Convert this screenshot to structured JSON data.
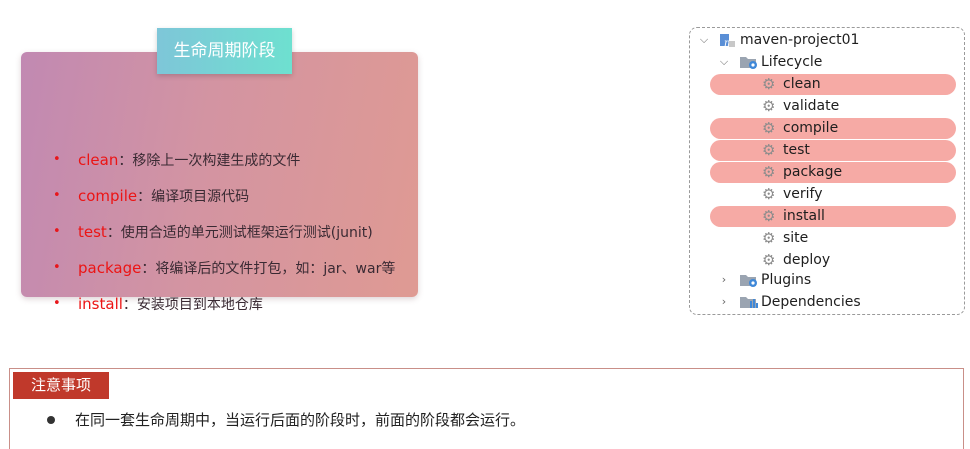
{
  "lifecycle_card": {
    "title": "生命周期阶段",
    "items": [
      {
        "term": "clean",
        "desc": "：移除上一次构建生成的文件"
      },
      {
        "term": "compile",
        "desc": "：编译项目源代码"
      },
      {
        "term": "test",
        "desc": "：使用合适的单元测试框架运行测试(junit)"
      },
      {
        "term": "package",
        "desc": "：将编译后的文件打包，如：jar、war等"
      },
      {
        "term": "install",
        "desc": "：安装项目到本地仓库"
      }
    ]
  },
  "project_tree": {
    "project": "maven-project01",
    "lifecycle_label": "Lifecycle",
    "phases": [
      {
        "label": "clean",
        "highlighted": true
      },
      {
        "label": "validate",
        "highlighted": false
      },
      {
        "label": "compile",
        "highlighted": true
      },
      {
        "label": "test",
        "highlighted": true
      },
      {
        "label": "package",
        "highlighted": true
      },
      {
        "label": "verify",
        "highlighted": false
      },
      {
        "label": "install",
        "highlighted": true
      },
      {
        "label": "site",
        "highlighted": false
      },
      {
        "label": "deploy",
        "highlighted": false
      }
    ],
    "plugins_label": "Plugins",
    "dependencies_label": "Dependencies",
    "icons": {
      "expanded": "chevron-down-icon",
      "collapsed": "chevron-right-icon",
      "project": "maven-project-icon",
      "folder": "folder-icon",
      "phase": "gear-icon"
    }
  },
  "notice": {
    "tag": "注意事项",
    "text": "在同一套生命周期中，当运行后面的阶段时，前面的阶段都会运行。"
  },
  "colors": {
    "highlight": "#f6aaa5",
    "term": "#ec1414",
    "notice_tag": "#c0392b",
    "title_gradient_start": "#7ec6d8",
    "title_gradient_end": "#6ee0d0"
  }
}
